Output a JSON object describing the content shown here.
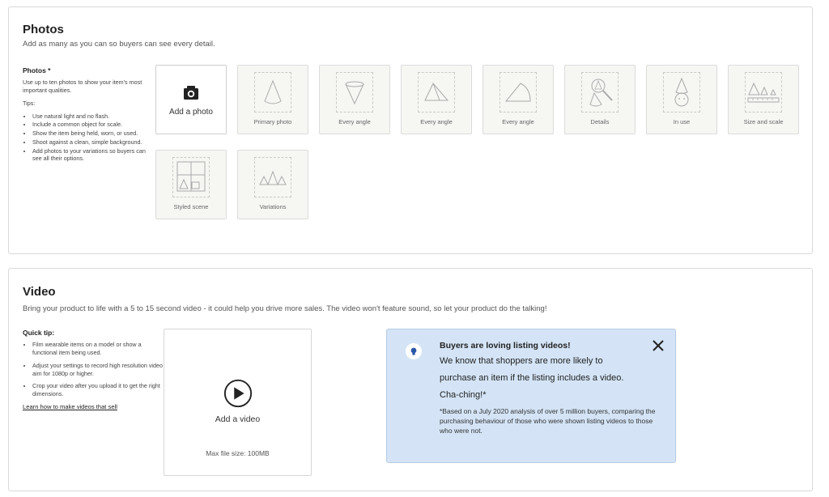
{
  "photos": {
    "title": "Photos",
    "subtitle": "Add as many as you can so buyers can see every detail.",
    "side_label": "Photos *",
    "side_desc": "Use up to ten photos to show your item's most important qualities.",
    "tips_label": "Tips:",
    "tips": [
      "Use natural light and no flash.",
      "Include a common object for scale.",
      "Show the item being held, worn, or used.",
      "Shoot against a clean, simple background.",
      "Add photos to your variations so buyers can see all their options."
    ],
    "add_label": "Add a photo",
    "tiles": [
      "Primary photo",
      "Every angle",
      "Every angle",
      "Every angle",
      "Details",
      "In use",
      "Size and scale",
      "Styled scene",
      "Variations"
    ]
  },
  "video": {
    "title": "Video",
    "subtitle": "Bring your product to life with a 5 to 15 second video - it could help you drive more sales. The video won't feature sound, so let your product do the talking!",
    "tip_label": "Quick tip:",
    "tips": [
      "Film wearable items on a model or show a functional item being used.",
      "Adjust your settings to record high resolution video - aim for 1080p or higher.",
      "Crop your video after you upload it to get the right dimensions."
    ],
    "learn_link": "Learn how to make videos that sell",
    "add_label": "Add a video",
    "max_size": "Max file size: 100MB",
    "info": {
      "title": "Buyers are loving listing videos!",
      "body": "We know that shoppers are more likely to purchase an item if the listing includes a video. Cha-ching!*",
      "foot": "*Based on a July 2020 analysis of over 5 million buyers, comparing the purchasing behaviour of those who were shown listing videos to those who were not."
    }
  },
  "icons": {
    "camera": "camera-icon",
    "play": "play-icon",
    "lightbulb": "lightbulb-icon",
    "close": "close-icon"
  },
  "colors": {
    "info_bg": "#d4e4f6",
    "info_border": "#b4cbe6",
    "tile_bg": "#f6f6f3"
  }
}
